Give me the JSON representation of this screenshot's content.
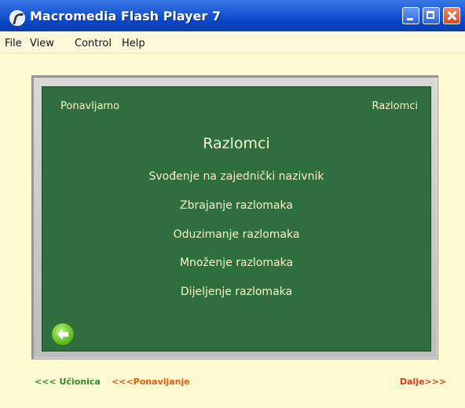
{
  "window": {
    "title": "Macromedia Flash Player 7",
    "title_bar_color": "#0a46c4"
  },
  "menu": {
    "items": [
      {
        "label": "File",
        "mnemonic": "F"
      },
      {
        "label": "View",
        "mnemonic": "V"
      },
      {
        "label": "Control",
        "mnemonic": "C"
      },
      {
        "label": "Help",
        "mnemonic": "H"
      }
    ]
  },
  "board": {
    "corner_left": "Ponavljamo",
    "corner_right": "Razlomci",
    "title": "Razlomci",
    "topics": [
      "Svođenje na zajednički nazivnik",
      "Zbrajanje razlomaka",
      "Oduzimanje razlomaka",
      "Množenje razlomaka",
      "Dijeljenje razlomaka"
    ],
    "board_color": "#2f6e3f",
    "text_color": "#f6f4c8"
  },
  "nav": {
    "back_icon": "arrow-left-icon",
    "link_ucionica": "<<< Učionica",
    "link_ponavljanje": "<<<Ponavljanje",
    "link_dalje": "Dalje>>>"
  }
}
